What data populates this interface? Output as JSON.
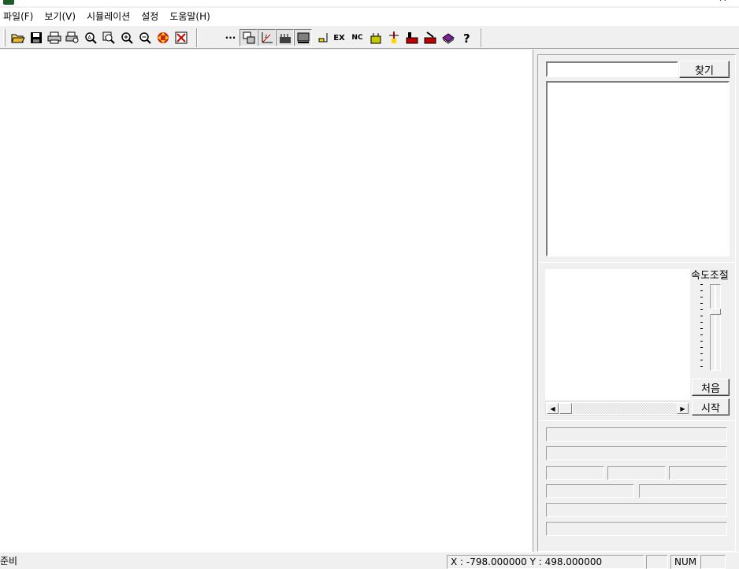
{
  "titlebar": {
    "title": "",
    "minimize_glyph": "—",
    "close_glyph": "✕"
  },
  "menu": [
    {
      "label": "파일(F)"
    },
    {
      "label": "보기(V)"
    },
    {
      "label": "시뮬레이션"
    },
    {
      "label": "설정"
    },
    {
      "label": "도움말(H)"
    }
  ],
  "toolbar": {
    "icons": [
      "open-folder-icon",
      "save-icon",
      "print-icon",
      "print-preview-icon",
      "zoom-fit-icon",
      "zoom-window-icon",
      "zoom-in-icon",
      "zoom-out-icon",
      "pan-icon",
      "clear-icon",
      "more-icon",
      "view-toggle-icon",
      "axis-icon",
      "ruler-icon",
      "panel-icon",
      "cursor-icon",
      "ex-icon",
      "nc-icon",
      "tool-icon",
      "marker-icon",
      "machine-icon",
      "edit-icon",
      "book-icon",
      "help-icon"
    ],
    "more_glyph": "···",
    "ex_text": "EX",
    "nc_text": "NC"
  },
  "search": {
    "value": "",
    "button_label": "찾기"
  },
  "speed": {
    "label": "속도조절"
  },
  "buttons": {
    "first_label": "처음",
    "start_label": "시작"
  },
  "status": {
    "ready": "준비",
    "coords": "X : -798.000000    Y : 498.000000",
    "num": "NUM"
  }
}
